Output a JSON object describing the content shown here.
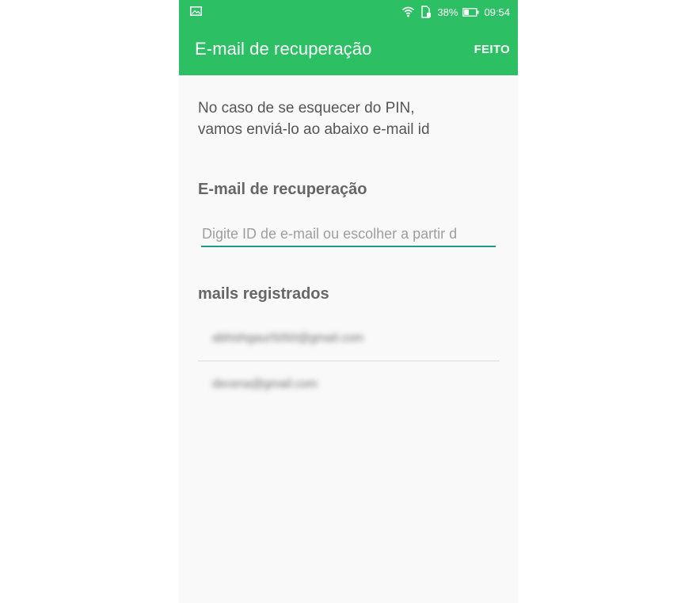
{
  "status_bar": {
    "battery_percent": "38%",
    "time": "09:54",
    "icons": [
      "image-notification-icon",
      "wifi-icon",
      "sim-icon",
      "battery-icon"
    ]
  },
  "toolbar": {
    "title": "E-mail de recuperação",
    "done_label": "FEITO"
  },
  "description": {
    "line1": "No caso de se esquecer do PIN,",
    "line2": "vamos enviá-lo ao abaixo e-mail id"
  },
  "recovery_field": {
    "label": "E-mail de recuperação",
    "placeholder": "Digite ID de e-mail ou escolher a partir d",
    "value": ""
  },
  "registered": {
    "title": "mails registrados",
    "emails": [
      "abhishgaur5050@gmail.com",
      "decena@gmail.com"
    ]
  },
  "colors": {
    "accent": "#2dbf64",
    "input_underline": "#1e9a8a"
  }
}
